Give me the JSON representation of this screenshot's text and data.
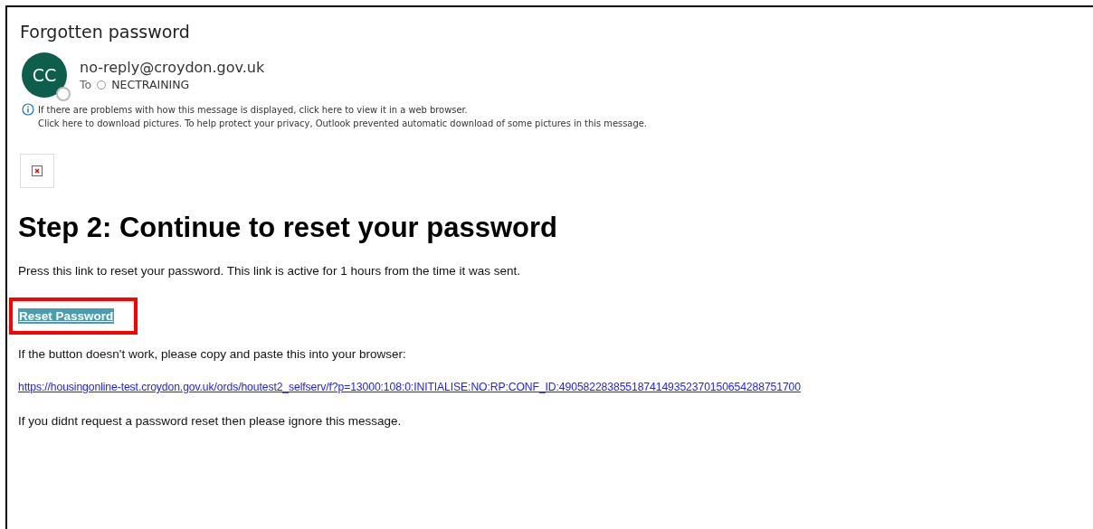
{
  "subject": "Forgotten password",
  "sender": {
    "initials": "CC",
    "address": "no-reply@croydon.gov.uk",
    "to_label": "To",
    "recipient": "NECTRAINING"
  },
  "info_lines": [
    "If there are problems with how this message is displayed, click here to view it in a web browser.",
    "Click here to download pictures. To help protect your privacy, Outlook prevented automatic download of some pictures in this message."
  ],
  "heading": "Step 2: Continue to reset your password",
  "intro": "Press this link to reset your password. This link is active for 1 hours from the time it was sent.",
  "reset_button": {
    "label": "Reset Password",
    "highlighted": true
  },
  "fallback_text": "If the button doesn't work, please copy and paste this into your browser:",
  "url": "https://housingonline-test.croydon.gov.uk/ords/houtest2_selfserv/f?p=13000:108:0:INITIALISE:NO:RP:CONF_ID:4905822838551874149352370150654288751700",
  "footer": "If you didnt request a password reset then please ignore this message."
}
